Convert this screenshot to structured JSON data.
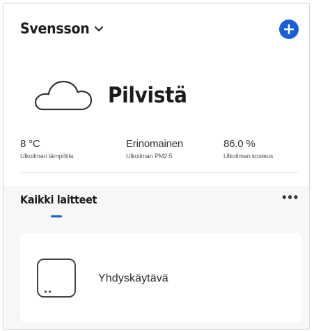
{
  "header": {
    "home_name": "Svensson",
    "dropdown_icon": "chevron-down-icon",
    "add_icon": "plus-icon",
    "accent_color": "#1b5fd6"
  },
  "weather": {
    "icon": "cloud-icon",
    "condition": "Pilvistä",
    "stats": [
      {
        "value": "8 °C",
        "label": "Ulkoilman lämpötila"
      },
      {
        "value": "Erinomainen",
        "label": "Ulkoilman PM2.5"
      },
      {
        "value": "86.0 %",
        "label": "Ulkoilman kosteus"
      }
    ]
  },
  "devices_section": {
    "title": "Kaikki laitteet",
    "more_icon": "more-horizontal-icon"
  },
  "devices": [
    {
      "name": "Yhdyskäytävä",
      "icon": "gateway-icon"
    }
  ]
}
